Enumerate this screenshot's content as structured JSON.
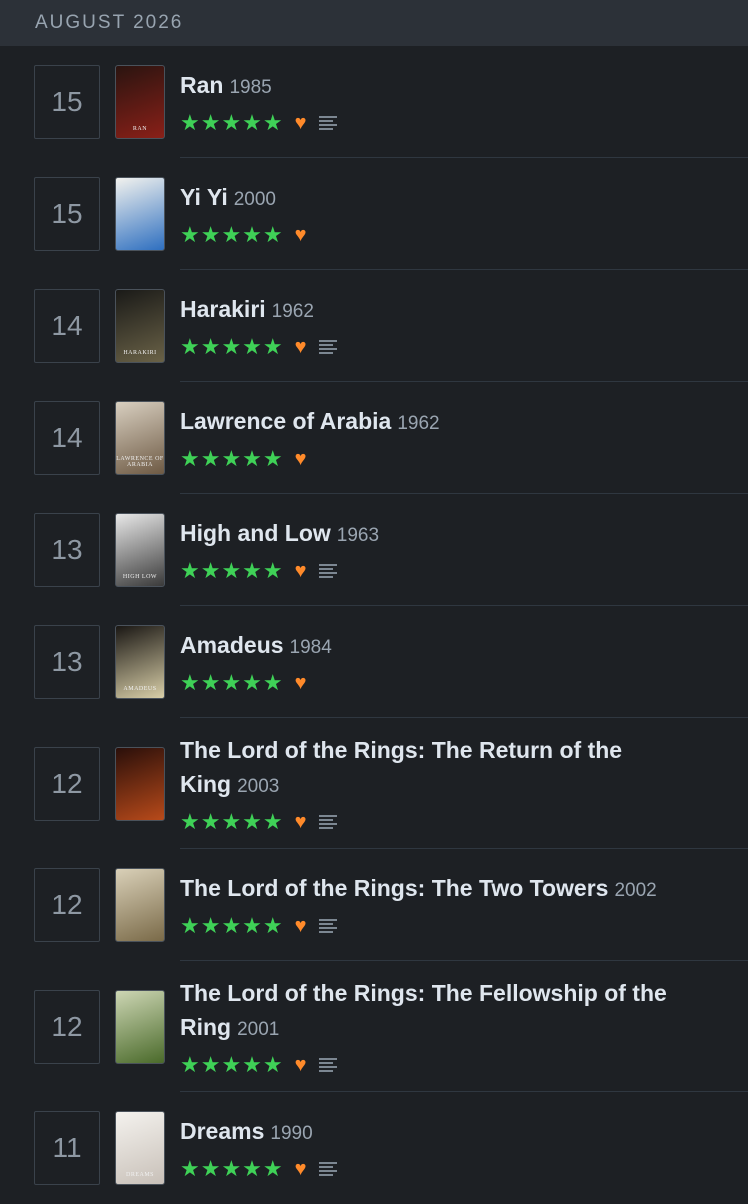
{
  "header": {
    "month": "AUGUST 2026"
  },
  "entries": [
    {
      "day": "15",
      "title": "Ran",
      "year": "1985",
      "stars": "★★★★★",
      "rating": 5,
      "liked": true,
      "has_review": true,
      "poster_text": "RAN",
      "poster_colors": [
        "#2a1410",
        "#8a2018"
      ],
      "lines": 1
    },
    {
      "day": "15",
      "title": "Yi Yi",
      "year": "2000",
      "stars": "★★★★★",
      "rating": 5,
      "liked": true,
      "has_review": false,
      "poster_text": "",
      "poster_colors": [
        "#f2f2ee",
        "#2e6fc0"
      ],
      "lines": 1
    },
    {
      "day": "14",
      "title": "Harakiri",
      "year": "1962",
      "stars": "★★★★★",
      "rating": 5,
      "liked": true,
      "has_review": true,
      "poster_text": "HARAKIRI",
      "poster_colors": [
        "#1a1a18",
        "#6a6247"
      ],
      "lines": 1
    },
    {
      "day": "14",
      "title": "Lawrence of Arabia",
      "year": "1962",
      "stars": "★★★★★",
      "rating": 5,
      "liked": true,
      "has_review": false,
      "poster_text": "LAWRENCE OF ARABIA",
      "poster_colors": [
        "#d8cfc0",
        "#6e5a44"
      ],
      "lines": 1
    },
    {
      "day": "13",
      "title": "High and Low",
      "year": "1963",
      "stars": "★★★★★",
      "rating": 5,
      "liked": true,
      "has_review": true,
      "poster_text": "HIGH LOW",
      "poster_colors": [
        "#e8e8e8",
        "#3a3a3a"
      ],
      "lines": 1
    },
    {
      "day": "13",
      "title": "Amadeus",
      "year": "1984",
      "stars": "★★★★★",
      "rating": 5,
      "liked": true,
      "has_review": false,
      "poster_text": "AMADEUS",
      "poster_colors": [
        "#1a1714",
        "#d9cfa8"
      ],
      "lines": 1
    },
    {
      "day": "12",
      "title": "The Lord of the Rings: The Return of the King",
      "year": "2003",
      "stars": "★★★★★",
      "rating": 5,
      "liked": true,
      "has_review": true,
      "poster_text": "",
      "poster_colors": [
        "#2a0f0a",
        "#b84a1a"
      ],
      "lines": 2
    },
    {
      "day": "12",
      "title": "The Lord of the Rings: The Two Towers",
      "year": "2002",
      "stars": "★★★★★",
      "rating": 5,
      "liked": true,
      "has_review": true,
      "poster_text": "",
      "poster_colors": [
        "#d9d0b8",
        "#7a6a48"
      ],
      "lines": 1
    },
    {
      "day": "12",
      "title": "The Lord of the Rings: The Fellowship of the Ring",
      "year": "2001",
      "stars": "★★★★★",
      "rating": 5,
      "liked": true,
      "has_review": true,
      "poster_text": "",
      "poster_colors": [
        "#cdd6b4",
        "#4a6a2a"
      ],
      "lines": 2
    },
    {
      "day": "11",
      "title": "Dreams",
      "year": "1990",
      "stars": "★★★★★",
      "rating": 5,
      "liked": true,
      "has_review": true,
      "poster_text": "DREAMS",
      "poster_colors": [
        "#f4f2ee",
        "#c8c0b8"
      ],
      "lines": 1
    }
  ],
  "colors": {
    "background": "#1d2024",
    "header": "#2c3138",
    "star": "#3fd157",
    "heart": "#ff8a2a"
  }
}
